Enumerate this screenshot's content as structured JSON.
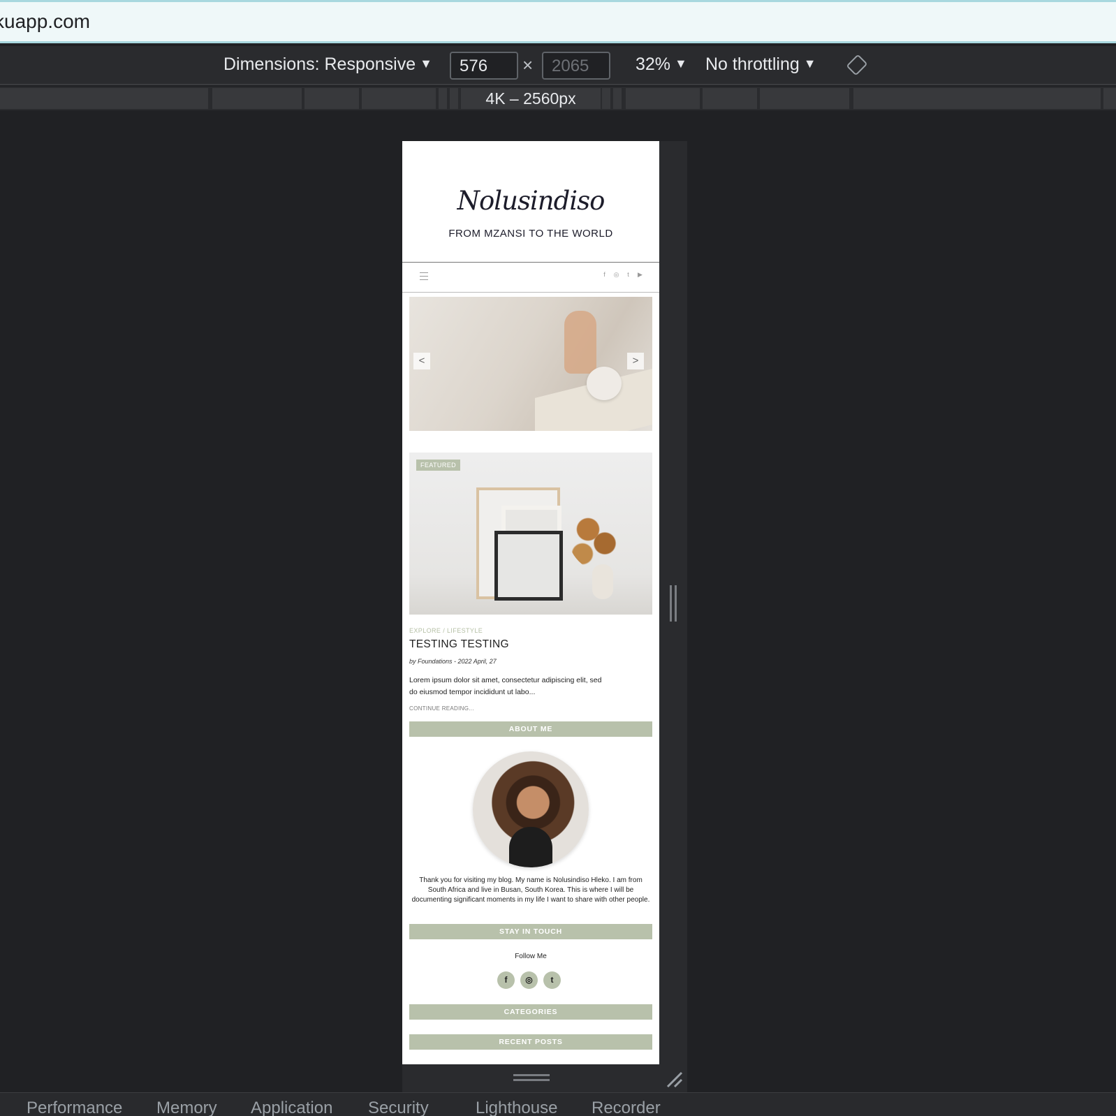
{
  "browser": {
    "url": "kuapp.com"
  },
  "device_toolbar": {
    "dimensions_label": "Dimensions: Responsive",
    "width_value": "576",
    "height_placeholder": "2065",
    "times": "×",
    "zoom": "32%",
    "throttling": "No throttling",
    "breakpoint_label": "4K – 2560px"
  },
  "site": {
    "title": "Nolusindiso",
    "tagline": "FROM MZANSI TO THE WORLD",
    "nav_social": [
      "f",
      "◎",
      "t",
      "▶"
    ],
    "slider": {
      "prev": "<",
      "next": ">"
    },
    "featured_badge": "FEATURED",
    "post": {
      "category": "EXPLORE / LIFESTYLE",
      "title": "TESTING TESTING",
      "meta": "by Foundations - 2022 April, 27",
      "excerpt": "Lorem ipsum dolor sit amet, consectetur adipiscing elit, sed do eiusmod tempor incididunt ut labo...",
      "continue": "CONTINUE READING..."
    },
    "about_heading": "ABOUT ME",
    "about_text": "Thank you for visiting my blog. My name is Nolusindiso Hleko. I am from South Africa and live in Busan, South Korea. This is where I will be documenting significant moments in my life I want to share with other people.",
    "stay_heading": "STAY IN TOUCH",
    "follow_label": "Follow Me",
    "follow_icons": [
      "f",
      "◎",
      "t"
    ],
    "categories_heading": "CATEGORIES",
    "recent_heading": "RECENT POSTS"
  },
  "devtools_tabs": [
    "Performance",
    "Memory",
    "Application",
    "Security",
    "Lighthouse",
    "Recorder"
  ],
  "colors": {
    "accent": "#b8c1ab",
    "devtools_bg": "#202124"
  }
}
